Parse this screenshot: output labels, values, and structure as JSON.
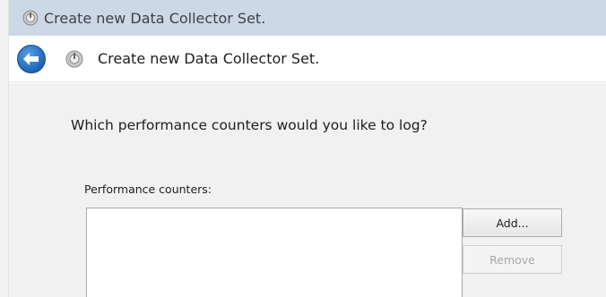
{
  "window": {
    "title": "Create new Data Collector Set."
  },
  "header": {
    "title": "Create new Data Collector Set.",
    "back_icon": "back-arrow-icon",
    "wizard_icon": "data-collector-icon"
  },
  "page": {
    "question": "Which performance counters would you like to log?"
  },
  "counters": {
    "label": "Performance counters:",
    "items": []
  },
  "buttons": {
    "add": "Add...",
    "remove": "Remove"
  },
  "colors": {
    "titlebar_bg": "#cdd8e6",
    "content_bg": "#f1f1f1",
    "back_button": "#1e6fc0"
  }
}
